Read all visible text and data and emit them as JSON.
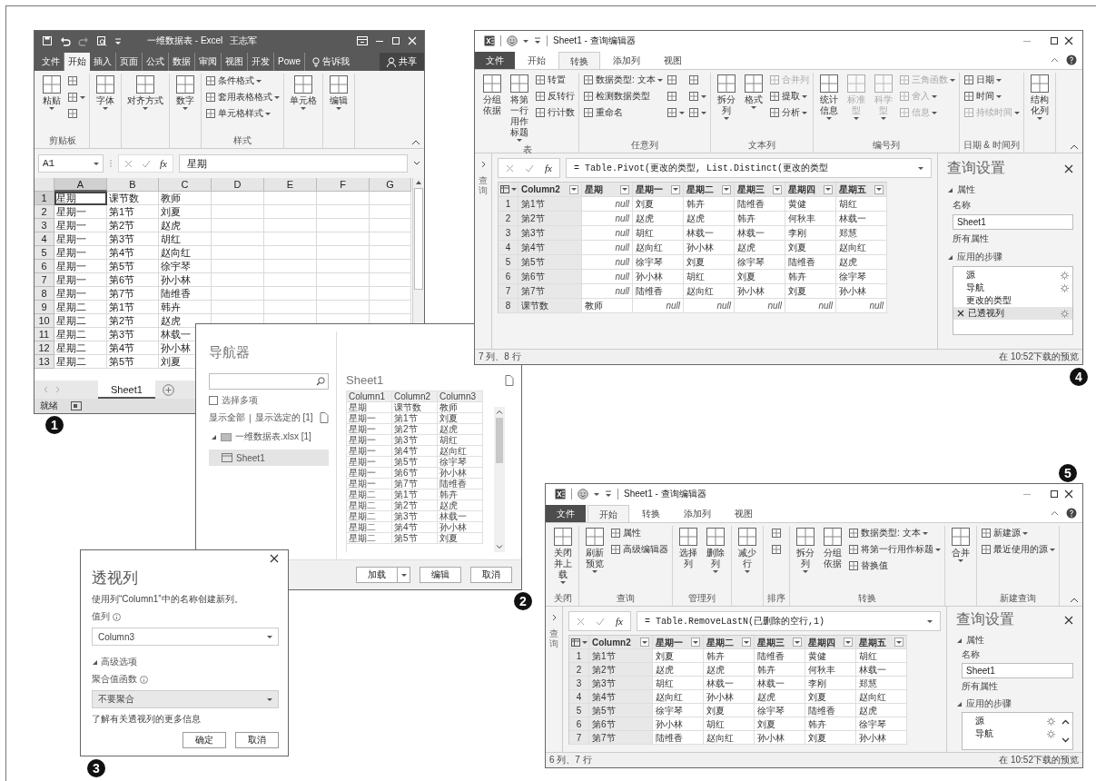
{
  "excel": {
    "title": "一维数据表 - Excel",
    "user": "王志军",
    "tabs": [
      {
        "label": "文件",
        "selected": false
      },
      {
        "label": "开始",
        "selected": true
      },
      {
        "label": "插入",
        "selected": false
      },
      {
        "label": "页面",
        "selected": false
      },
      {
        "label": "公式",
        "selected": false
      },
      {
        "label": "数据",
        "selected": false
      },
      {
        "label": "审阅",
        "selected": false
      },
      {
        "label": "视图",
        "selected": false
      },
      {
        "label": "开发",
        "selected": false
      },
      {
        "label": "Powe",
        "selected": false
      }
    ],
    "tell_me": "告诉我",
    "share": "共享",
    "ribbon": [
      {
        "label": "剪贴板",
        "items": [
          {
            "kind": "large",
            "label": "粘贴",
            "dropdown": true,
            "disabled": false
          },
          {
            "kind": "icon",
            "dropdown": false,
            "disabled": false
          },
          {
            "kind": "icon",
            "dropdown": true,
            "disabled": false
          },
          {
            "kind": "icon",
            "dropdown": false,
            "disabled": false
          }
        ]
      },
      {
        "items": [
          {
            "kind": "large",
            "label": "字体",
            "dropdown": true,
            "disabled": false
          }
        ]
      },
      {
        "items": [
          {
            "kind": "large",
            "label": "对齐方式",
            "dropdown": true,
            "disabled": false
          }
        ]
      },
      {
        "items": [
          {
            "kind": "large",
            "label": "数字",
            "dropdown": true,
            "disabled": false
          }
        ]
      },
      {
        "label": "样式",
        "items": [
          {
            "kind": "small",
            "label": "条件格式",
            "dropdown": true,
            "disabled": false
          },
          {
            "kind": "small",
            "label": "套用表格格式",
            "dropdown": true,
            "disabled": false
          },
          {
            "kind": "small",
            "label": "单元格样式",
            "dropdown": true,
            "disabled": false
          }
        ]
      },
      {
        "items": [
          {
            "kind": "large",
            "label": "单元格",
            "dropdown": true,
            "disabled": false
          }
        ]
      },
      {
        "items": [
          {
            "kind": "large",
            "label": "编辑",
            "dropdown": true,
            "disabled": false
          }
        ]
      }
    ],
    "name_box": "A1",
    "fx": "fx",
    "formula": "星期",
    "columns": [
      {
        "label": "A",
        "selected": true
      },
      {
        "label": "B",
        "selected": false
      },
      {
        "label": "C",
        "selected": false
      },
      {
        "label": "D",
        "selected": false
      },
      {
        "label": "E",
        "selected": false
      },
      {
        "label": "F",
        "selected": false
      },
      {
        "label": "G",
        "selected": false
      }
    ],
    "rows": [
      {
        "num": "1",
        "selected": true,
        "cells": [
          "星期",
          "课节数",
          "教师"
        ]
      },
      {
        "num": "2",
        "selected": false,
        "cells": [
          "星期一",
          "第1节",
          "刘夏"
        ]
      },
      {
        "num": "3",
        "selected": false,
        "cells": [
          "星期一",
          "第2节",
          "赵虎"
        ]
      },
      {
        "num": "4",
        "selected": false,
        "cells": [
          "星期一",
          "第3节",
          "胡红"
        ]
      },
      {
        "num": "5",
        "selected": false,
        "cells": [
          "星期一",
          "第4节",
          "赵向红"
        ]
      },
      {
        "num": "6",
        "selected": false,
        "cells": [
          "星期一",
          "第5节",
          "徐宇琴"
        ]
      },
      {
        "num": "7",
        "selected": false,
        "cells": [
          "星期一",
          "第6节",
          "孙小林"
        ]
      },
      {
        "num": "8",
        "selected": false,
        "cells": [
          "星期一",
          "第7节",
          "陆维香"
        ]
      },
      {
        "num": "9",
        "selected": false,
        "cells": [
          "星期二",
          "第1节",
          "韩卉"
        ]
      },
      {
        "num": "10",
        "selected": false,
        "cells": [
          "星期二",
          "第2节",
          "赵虎"
        ]
      },
      {
        "num": "11",
        "selected": false,
        "cells": [
          "星期二",
          "第3节",
          "林载一"
        ]
      },
      {
        "num": "12",
        "selected": false,
        "cells": [
          "星期二",
          "第4节",
          "孙小林"
        ]
      },
      {
        "num": "13",
        "selected": false,
        "cells": [
          "星期二",
          "第5节",
          "刘夏"
        ]
      }
    ],
    "sheet_tab": {
      "label": "Sheet1",
      "selected": true
    },
    "status": "就绪"
  },
  "navigator": {
    "title": "导航器",
    "select_multiple": {
      "label": "选择多项",
      "checked": false
    },
    "links": [
      "显示全部",
      "显示选定的 [1]"
    ],
    "separator": "|",
    "tree": [
      {
        "label": "一维数据表.xlsx [1]",
        "expanded": true,
        "selected": false,
        "children": [
          {
            "label": "Sheet1",
            "selected": true
          }
        ]
      }
    ],
    "preview": {
      "title": "Sheet1",
      "columns": [
        "Column1",
        "Column2",
        "Column3"
      ],
      "rows": [
        [
          "星期",
          "课节数",
          "教师"
        ],
        [
          "星期一",
          "第1节",
          "刘夏"
        ],
        [
          "星期一",
          "第2节",
          "赵虎"
        ],
        [
          "星期一",
          "第3节",
          "胡红"
        ],
        [
          "星期一",
          "第4节",
          "赵向红"
        ],
        [
          "星期一",
          "第5节",
          "徐宇琴"
        ],
        [
          "星期一",
          "第6节",
          "孙小林"
        ],
        [
          "星期一",
          "第7节",
          "陆维香"
        ],
        [
          "星期二",
          "第1节",
          "韩卉"
        ],
        [
          "星期二",
          "第2节",
          "赵虎"
        ],
        [
          "星期二",
          "第3节",
          "林载一"
        ],
        [
          "星期二",
          "第4节",
          "孙小林"
        ],
        [
          "星期二",
          "第5节",
          "刘夏"
        ]
      ]
    },
    "buttons": [
      {
        "label": "加载",
        "dropdown": true
      },
      {
        "label": "编辑",
        "dropdown": false
      },
      {
        "label": "取消",
        "dropdown": false
      }
    ]
  },
  "pivot": {
    "title": "透视列",
    "description": "使用列“Column1”中的名称创建新列。",
    "value_label": "值列",
    "value": "Column3",
    "advanced": {
      "label": "高级选项",
      "expanded": true
    },
    "agg_label": "聚合值函数",
    "agg_value": "不要聚合",
    "link": "了解有关透视列的更多信息",
    "buttons": [
      "确定",
      "取消"
    ]
  },
  "editors": [
    {
      "title": "Sheet1 - 查询编辑器",
      "tabs": [
        {
          "label": "文件",
          "kind": "menu",
          "selected": false
        },
        {
          "label": "开始",
          "kind": "tab",
          "selected": false
        },
        {
          "label": "转换",
          "kind": "tab",
          "selected": true
        },
        {
          "label": "添加列",
          "kind": "tab",
          "selected": false
        },
        {
          "label": "视图",
          "kind": "tab",
          "selected": false
        }
      ],
      "ribbon": [
        {
          "label": "表",
          "items": [
            {
              "kind": "large",
              "label": "分组依据",
              "dropdown": false,
              "disabled": false
            },
            {
              "kind": "large",
              "label": "将第一行用作标题",
              "dropdown": true,
              "disabled": false
            },
            {
              "kind": "small",
              "label": "转置",
              "dropdown": false,
              "disabled": false
            },
            {
              "kind": "small",
              "label": "反转行",
              "dropdown": false,
              "disabled": false
            },
            {
              "kind": "small",
              "label": "行计数",
              "dropdown": false,
              "disabled": false
            }
          ]
        },
        {
          "label": "任意列",
          "items": [
            {
              "kind": "small",
              "label": "数据类型: 文本",
              "dropdown": true,
              "disabled": false
            },
            {
              "kind": "small",
              "label": "检测数据类型",
              "dropdown": false,
              "disabled": false
            },
            {
              "kind": "small",
              "label": "重命名",
              "dropdown": false,
              "disabled": false
            },
            {
              "kind": "icon",
              "dropdown": false,
              "disabled": false
            },
            {
              "kind": "icon",
              "dropdown": false,
              "disabled": false
            },
            {
              "kind": "icon",
              "dropdown": true,
              "disabled": false
            },
            {
              "kind": "icon",
              "dropdown": false,
              "disabled": false
            },
            {
              "kind": "icon",
              "dropdown": true,
              "disabled": false
            },
            {
              "kind": "icon",
              "dropdown": true,
              "disabled": false
            }
          ]
        },
        {
          "label": "文本列",
          "items": [
            {
              "kind": "large",
              "label": "拆分列",
              "dropdown": true,
              "disabled": false
            },
            {
              "kind": "large",
              "label": "格式",
              "dropdown": true,
              "disabled": false
            },
            {
              "kind": "small",
              "label": "合并列",
              "dropdown": false,
              "disabled": true
            },
            {
              "kind": "small",
              "label": "提取",
              "dropdown": true,
              "disabled": false
            },
            {
              "kind": "small",
              "label": "分析",
              "dropdown": true,
              "disabled": false
            }
          ]
        },
        {
          "label": "编号列",
          "items": [
            {
              "kind": "large",
              "label": "统计信息",
              "dropdown": true,
              "disabled": false
            },
            {
              "kind": "large",
              "label": "标准型",
              "dropdown": true,
              "disabled": true
            },
            {
              "kind": "large",
              "label": "科学型",
              "dropdown": true,
              "disabled": true
            },
            {
              "kind": "small",
              "label": "三角函数",
              "dropdown": true,
              "disabled": true
            },
            {
              "kind": "small",
              "label": "舍入",
              "dropdown": true,
              "disabled": true
            },
            {
              "kind": "small",
              "label": "信息",
              "dropdown": true,
              "disabled": true
            }
          ]
        },
        {
          "label": "日期 & 时间列",
          "items": [
            {
              "kind": "small",
              "label": "日期",
              "dropdown": true,
              "disabled": false
            },
            {
              "kind": "small",
              "label": "时间",
              "dropdown": true,
              "disabled": false
            },
            {
              "kind": "small",
              "label": "持续时间",
              "dropdown": true,
              "disabled": true
            }
          ]
        },
        {
          "items": [
            {
              "kind": "large",
              "label": "结构化列",
              "dropdown": true,
              "disabled": false
            }
          ]
        }
      ],
      "queries_label": "查询",
      "fx": "fx",
      "formula": "= Table.Pivot(更改的类型, List.Distinct(更改的类型",
      "columns": [
        {
          "label": "Column2",
          "selected": true
        },
        {
          "label": "星期",
          "selected": false
        },
        {
          "label": "星期一",
          "selected": false
        },
        {
          "label": "星期二",
          "selected": false
        },
        {
          "label": "星期三",
          "selected": false
        },
        {
          "label": "星期四",
          "selected": false
        },
        {
          "label": "星期五",
          "selected": false
        }
      ],
      "rows": [
        {
          "num": "1",
          "cells": [
            "第1节",
            {
              "text": "null",
              "kind": "null"
            },
            "刘夏",
            "韩卉",
            "陆维香",
            "黄健",
            "胡红"
          ]
        },
        {
          "num": "2",
          "cells": [
            "第2节",
            {
              "text": "null",
              "kind": "null"
            },
            "赵虎",
            "赵虎",
            "韩卉",
            "何秋丰",
            "林载一"
          ]
        },
        {
          "num": "3",
          "cells": [
            "第3节",
            {
              "text": "null",
              "kind": "null"
            },
            "胡红",
            "林载一",
            "林载一",
            "李刚",
            "郑慧"
          ]
        },
        {
          "num": "4",
          "cells": [
            "第4节",
            {
              "text": "null",
              "kind": "null"
            },
            "赵向红",
            "孙小林",
            "赵虎",
            "刘夏",
            "赵向红"
          ]
        },
        {
          "num": "5",
          "cells": [
            "第5节",
            {
              "text": "null",
              "kind": "null"
            },
            "徐宇琴",
            "刘夏",
            "徐宇琴",
            "陆维香",
            "赵虎"
          ]
        },
        {
          "num": "6",
          "cells": [
            "第6节",
            {
              "text": "null",
              "kind": "null"
            },
            "孙小林",
            "胡红",
            "刘夏",
            "韩卉",
            "徐宇琴"
          ]
        },
        {
          "num": "7",
          "cells": [
            "第7节",
            {
              "text": "null",
              "kind": "null"
            },
            "陆维香",
            "赵向红",
            "孙小林",
            "刘夏",
            "孙小林"
          ]
        },
        {
          "num": "8",
          "cells": [
            "课节数",
            "教师",
            {
              "text": "null",
              "kind": "null"
            },
            {
              "text": "null",
              "kind": "null"
            },
            {
              "text": "null",
              "kind": "null"
            },
            {
              "text": "null",
              "kind": "null"
            },
            {
              "text": "null",
              "kind": "null"
            }
          ]
        }
      ],
      "settings": {
        "title": "查询设置",
        "properties": {
          "label": "属性",
          "expanded": true
        },
        "name_label": "名称",
        "name": "Sheet1",
        "all_properties": "所有属性",
        "steps_section": {
          "label": "应用的步骤",
          "expanded": true
        },
        "steps_scroll": false,
        "steps": [
          {
            "label": "源",
            "selected": false,
            "gear": true
          },
          {
            "label": "导航",
            "selected": false,
            "gear": true
          },
          {
            "label": "更改的类型",
            "selected": false,
            "gear": false
          },
          {
            "label": "已透视列",
            "selected": true,
            "gear": true
          }
        ]
      },
      "status_left": "7 列、8 行",
      "status_right": "在 10:52下载的预览"
    },
    {
      "title": "Sheet1 - 查询编辑器",
      "tabs": [
        {
          "label": "文件",
          "kind": "menu",
          "selected": false
        },
        {
          "label": "开始",
          "kind": "tab",
          "selected": true
        },
        {
          "label": "转换",
          "kind": "tab",
          "selected": false
        },
        {
          "label": "添加列",
          "kind": "tab",
          "selected": false
        },
        {
          "label": "视图",
          "kind": "tab",
          "selected": false
        }
      ],
      "ribbon": [
        {
          "label": "关闭",
          "items": [
            {
              "kind": "large",
              "label": "关闭并上载",
              "dropdown": true,
              "disabled": false
            }
          ]
        },
        {
          "label": "查询",
          "items": [
            {
              "kind": "large",
              "label": "刷新预览",
              "dropdown": true,
              "disabled": false
            },
            {
              "kind": "small",
              "label": "属性",
              "dropdown": false,
              "disabled": false
            },
            {
              "kind": "small",
              "label": "高级编辑器",
              "dropdown": false,
              "disabled": false
            }
          ]
        },
        {
          "label": "管理列",
          "items": [
            {
              "kind": "large",
              "label": "选择列",
              "dropdown": false,
              "disabled": false
            },
            {
              "kind": "large",
              "label": "删除列",
              "dropdown": true,
              "disabled": false
            }
          ]
        },
        {
          "items": [
            {
              "kind": "large",
              "label": "减少行",
              "dropdown": true,
              "disabled": false
            }
          ]
        },
        {
          "label": "排序",
          "items": [
            {
              "kind": "icon",
              "dropdown": false,
              "disabled": false
            },
            {
              "kind": "icon",
              "dropdown": false,
              "disabled": false
            }
          ]
        },
        {
          "label": "转换",
          "items": [
            {
              "kind": "large",
              "label": "拆分列",
              "dropdown": true,
              "disabled": false
            },
            {
              "kind": "large",
              "label": "分组依据",
              "dropdown": false,
              "disabled": false
            },
            {
              "kind": "small",
              "label": "数据类型: 文本",
              "dropdown": true,
              "disabled": false
            },
            {
              "kind": "small",
              "label": "将第一行用作标题",
              "dropdown": true,
              "disabled": false
            },
            {
              "kind": "small",
              "label": "替换值",
              "dropdown": false,
              "disabled": false
            }
          ]
        },
        {
          "items": [
            {
              "kind": "large",
              "label": "合并",
              "dropdown": true,
              "disabled": false
            }
          ]
        },
        {
          "label": "新建查询",
          "items": [
            {
              "kind": "small",
              "label": "新建源",
              "dropdown": true,
              "disabled": false
            },
            {
              "kind": "small",
              "label": "最近使用的源",
              "dropdown": true,
              "disabled": false
            }
          ]
        }
      ],
      "queries_label": "查询",
      "fx": "fx",
      "formula": "= Table.RemoveLastN(已删除的空行,1)",
      "columns": [
        {
          "label": "Column2",
          "selected": true
        },
        {
          "label": "星期一",
          "selected": false
        },
        {
          "label": "星期二",
          "selected": false
        },
        {
          "label": "星期三",
          "selected": false
        },
        {
          "label": "星期四",
          "selected": false
        },
        {
          "label": "星期五",
          "selected": false
        }
      ],
      "rows": [
        {
          "num": "1",
          "cells": [
            "第1节",
            "刘夏",
            "韩卉",
            "陆维香",
            "黄健",
            "胡红"
          ]
        },
        {
          "num": "2",
          "cells": [
            "第2节",
            "赵虎",
            "赵虎",
            "韩卉",
            "何秋丰",
            "林载一"
          ]
        },
        {
          "num": "3",
          "cells": [
            "第3节",
            "胡红",
            "林载一",
            "林载一",
            "李刚",
            "郑慧"
          ]
        },
        {
          "num": "4",
          "cells": [
            "第4节",
            "赵向红",
            "孙小林",
            "赵虎",
            "刘夏",
            "赵向红"
          ]
        },
        {
          "num": "5",
          "cells": [
            "第5节",
            "徐宇琴",
            "刘夏",
            "徐宇琴",
            "陆维香",
            "赵虎"
          ]
        },
        {
          "num": "6",
          "cells": [
            "第6节",
            "孙小林",
            "胡红",
            "刘夏",
            "韩卉",
            "徐宇琴"
          ]
        },
        {
          "num": "7",
          "cells": [
            "第7节",
            "陆维香",
            "赵向红",
            "孙小林",
            "刘夏",
            "孙小林"
          ]
        }
      ],
      "settings": {
        "title": "查询设置",
        "properties": {
          "label": "属性",
          "expanded": true
        },
        "name_label": "名称",
        "name": "Sheet1",
        "all_properties": "所有属性",
        "steps_section": {
          "label": "应用的步骤",
          "expanded": true
        },
        "steps_scroll": true,
        "steps": [
          {
            "label": "源",
            "selected": false,
            "gear": true
          },
          {
            "label": "导航",
            "selected": false,
            "gear": true
          }
        ]
      },
      "status_left": "6 列、7 行",
      "status_right": "在 10:52下载的预览"
    }
  ],
  "markers": [
    "1",
    "2",
    "3",
    "4",
    "5"
  ]
}
